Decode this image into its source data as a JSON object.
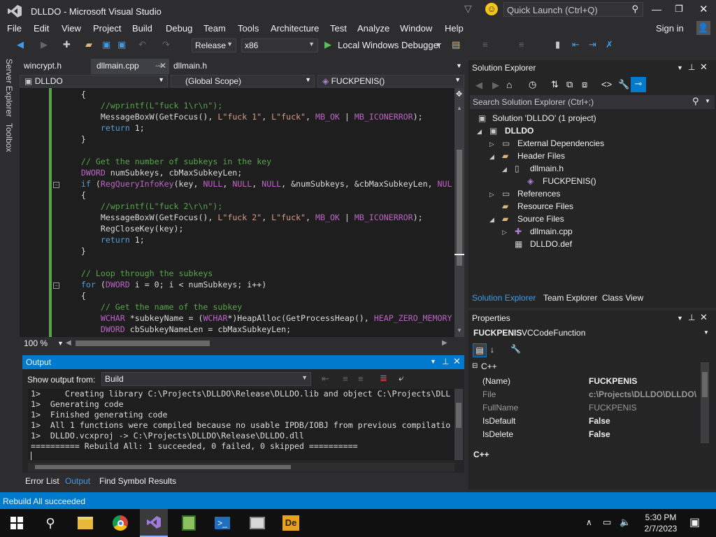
{
  "title": {
    "app": "DLLDO - Microsoft Visual Studio",
    "quick_launch_placeholder": "Quick Launch (Ctrl+Q)",
    "sign_in": "Sign in"
  },
  "menu": [
    "File",
    "Edit",
    "View",
    "Project",
    "Build",
    "Debug",
    "Team",
    "Tools",
    "Architecture",
    "Test",
    "Analyze",
    "Window",
    "Help"
  ],
  "toolbar": {
    "config": "Release",
    "platform": "x86",
    "debugger": "Local Windows Debugger"
  },
  "side_tabs": [
    "Server Explorer",
    "Toolbox"
  ],
  "editor_tabs": [
    "wincrypt.h",
    "dllmain.cpp",
    "dllmain.h"
  ],
  "nav": {
    "project": "DLLDO",
    "scope": "(Global Scope)",
    "member": "FUCKPENIS()"
  },
  "code_lines": [
    "    {",
    "        //wprintf(L\"fuck 1\\r\\n\");",
    "        MessageBoxW(GetFocus(), L\"fuck 1\", L\"fuck\", MB_OK | MB_ICONERROR);",
    "        return 1;",
    "    }",
    "",
    "    // Get the number of subkeys in the key",
    "    DWORD numSubkeys, cbMaxSubkeyLen;",
    "    if (RegQueryInfoKey(key, NULL, NULL, NULL, &numSubkeys, &cbMaxSubkeyLen, NUL",
    "    {",
    "        //wprintf(L\"fuck 2\\r\\n\");",
    "        MessageBoxW(GetFocus(), L\"fuck 2\", L\"fuck\", MB_OK | MB_ICONERROR);",
    "        RegCloseKey(key);",
    "        return 1;",
    "    }",
    "",
    "    // Loop through the subkeys",
    "    for (DWORD i = 0; i < numSubkeys; i++)",
    "    {",
    "        // Get the name of the subkey",
    "        WCHAR *subkeyName = (WCHAR*)HeapAlloc(GetProcessHeap(), HEAP_ZERO_MEMORY",
    "        DWORD cbSubkeyNameLen = cbMaxSubkeyLen;"
  ],
  "zoom": "100 %",
  "output": {
    "title": "Output",
    "show_from_label": "Show output from:",
    "source": "Build",
    "lines": [
      "1>     Creating library C:\\Projects\\DLLDO\\Release\\DLLDO.lib and object C:\\Projects\\DLL",
      "1>  Generating code",
      "1>  Finished generating code",
      "1>  All 1 functions were compiled because no usable IPDB/IOBJ from previous compilatio",
      "1>  DLLDO.vcxproj -> C:\\Projects\\DLLDO\\Release\\DLLDO.dll",
      "========== Rebuild All: 1 succeeded, 0 failed, 0 skipped =========="
    ]
  },
  "bottom_tabs": [
    "Error List",
    "Output",
    "Find Symbol Results"
  ],
  "solution_explorer": {
    "title": "Solution Explorer",
    "search_placeholder": "Search Solution Explorer (Ctrl+;)",
    "tree": [
      {
        "label": "Solution 'DLLDO' (1 project)",
        "depth": 0
      },
      {
        "label": "DLLDO",
        "depth": 1
      },
      {
        "label": "External Dependencies",
        "depth": 2
      },
      {
        "label": "Header Files",
        "depth": 2
      },
      {
        "label": "dllmain.h",
        "depth": 3
      },
      {
        "label": "FUCKPENIS()",
        "depth": 4
      },
      {
        "label": "References",
        "depth": 2
      },
      {
        "label": "Resource Files",
        "depth": 2
      },
      {
        "label": "Source Files",
        "depth": 2
      },
      {
        "label": "dllmain.cpp",
        "depth": 3
      },
      {
        "label": "DLLDO.def",
        "depth": 3
      }
    ],
    "tabs": [
      "Solution Explorer",
      "Team Explorer",
      "Class View"
    ]
  },
  "properties": {
    "title": "Properties",
    "object": "FUCKPENIS",
    "object_type": "VCCodeFunction",
    "category": "C++",
    "rows": [
      {
        "name": "(Name)",
        "value": "FUCKPENIS"
      },
      {
        "name": "File",
        "value": "c:\\Projects\\DLLDO\\DLLDO\\d"
      },
      {
        "name": "FullName",
        "value": "FUCKPENIS"
      },
      {
        "name": "IsDefault",
        "value": "False"
      },
      {
        "name": "IsDelete",
        "value": "False"
      }
    ],
    "footer": "C++"
  },
  "status": "Rebuild All succeeded",
  "clock": {
    "time": "5:30 PM",
    "date": "2/7/2023"
  },
  "colors": {
    "accent": "#007acc",
    "editor_bg": "#1e1e1e",
    "chrome": "#2d2d30"
  }
}
